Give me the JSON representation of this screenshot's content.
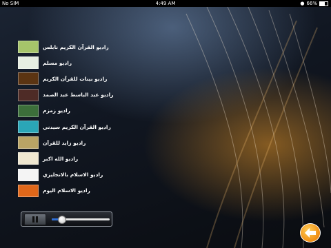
{
  "status_bar": {
    "carrier": "No SIM",
    "time": "4:49 AM",
    "battery": "66%",
    "battery_level": 0.66
  },
  "stations": [
    {
      "label": "راديو القرآن الكريم نابلس",
      "thumb_color": "#a6c46a",
      "icon": "station-thumbnail-icon"
    },
    {
      "label": "راديو مسلم",
      "thumb_color": "#e7efe2",
      "icon": "station-thumbnail-icon"
    },
    {
      "label": "راديو بينات للقرآن الكريم",
      "thumb_color": "#5b3412",
      "icon": "station-thumbnail-icon"
    },
    {
      "label": "راديو عبد الباسط عبد الصمد",
      "thumb_color": "#4e2b26",
      "icon": "station-thumbnail-icon"
    },
    {
      "label": "راديو زمزم",
      "thumb_color": "#3c6f3a",
      "icon": "station-thumbnail-icon"
    },
    {
      "label": "راديو القرآن الكريم سيدني",
      "thumb_color": "#2aa6b7",
      "icon": "station-thumbnail-icon"
    },
    {
      "label": "راديو زايد للقرآن",
      "thumb_color": "#b9a465",
      "icon": "station-thumbnail-icon"
    },
    {
      "label": "راديو الله اكبر",
      "thumb_color": "#efe7d0",
      "icon": "station-thumbnail-icon"
    },
    {
      "label": "راديو الاسلام بالانجليزي",
      "thumb_color": "#f4f4f4",
      "icon": "station-thumbnail-icon"
    },
    {
      "label": "راديو الاسلام اليوم",
      "thumb_color": "#e0671a",
      "icon": "station-thumbnail-icon"
    }
  ],
  "player": {
    "pause_icon": "pause-icon",
    "volume_level": 0.17
  },
  "back_button": {
    "icon": "arrow-left-icon",
    "color": "#f08d12"
  }
}
